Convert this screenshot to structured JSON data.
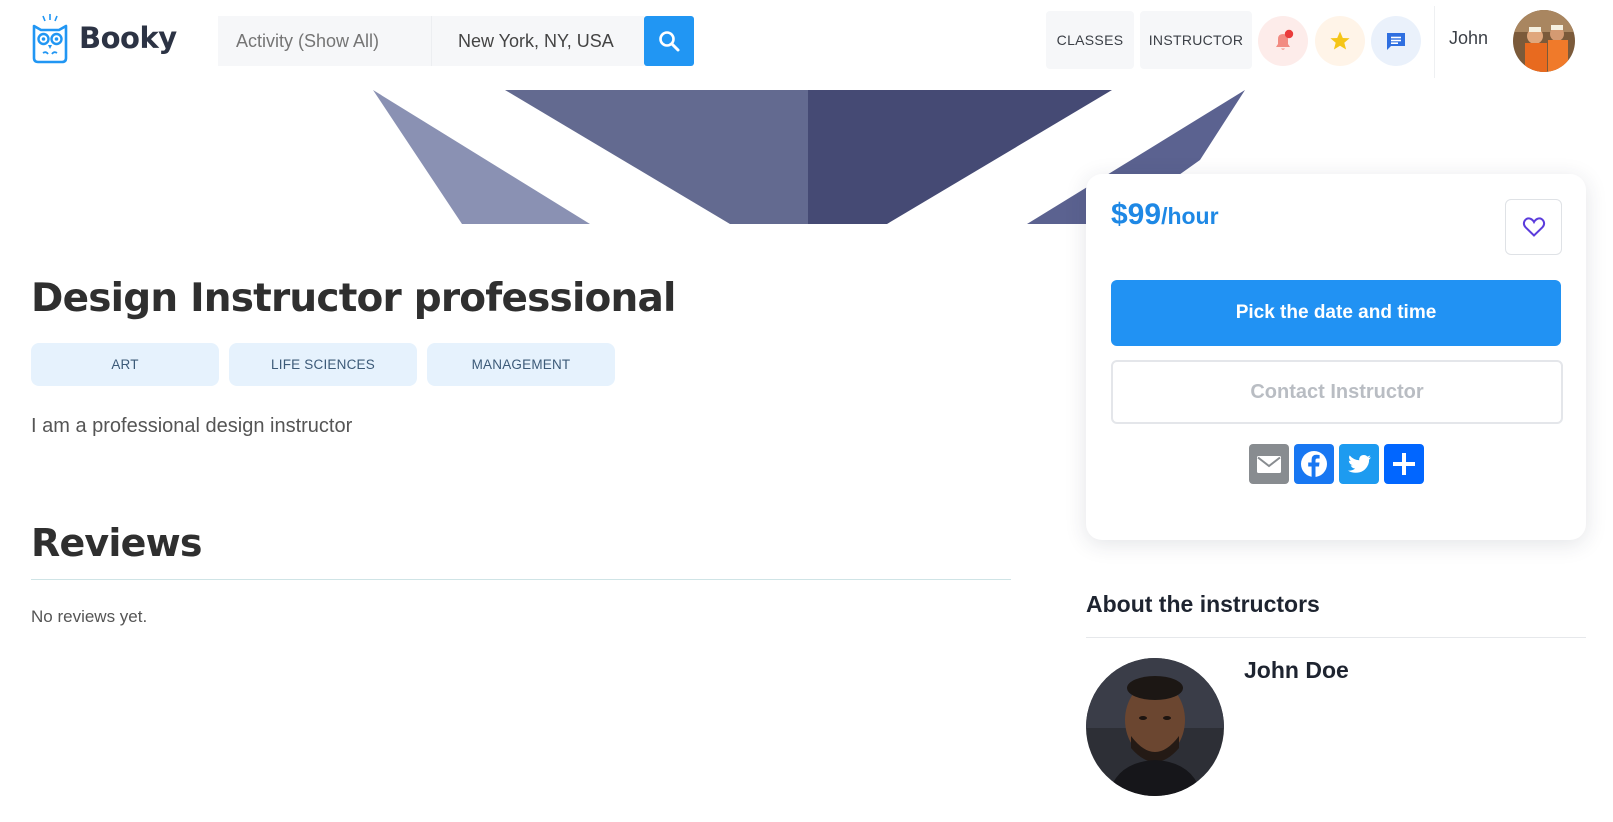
{
  "brand": {
    "name": "Booky",
    "accent": "#2196f3"
  },
  "search": {
    "activity_placeholder": "Activity (Show All)",
    "location_value": "New York, NY, USA",
    "button_icon": "search-icon"
  },
  "nav": {
    "classes": "CLASSES",
    "instructor": "INSTRUCTOR",
    "icons": [
      "bell-icon",
      "star-icon",
      "chat-icon"
    ]
  },
  "user": {
    "name": "John"
  },
  "course": {
    "title": "Design Instructor professional",
    "tags": [
      "ART",
      "LIFE SCIENCES",
      "MANAGEMENT"
    ],
    "description": "I am a professional design instructor"
  },
  "reviews": {
    "title": "Reviews",
    "empty_text": "No reviews yet."
  },
  "booking": {
    "price_amount": "$99",
    "price_unit": "/hour",
    "pick_label": "Pick the date and time",
    "contact_label": "Contact Instructor",
    "share_icons": [
      "email-icon",
      "facebook-icon",
      "twitter-icon",
      "add-icon"
    ]
  },
  "about": {
    "title": "About the instructors",
    "instructor_name": "John Doe"
  }
}
